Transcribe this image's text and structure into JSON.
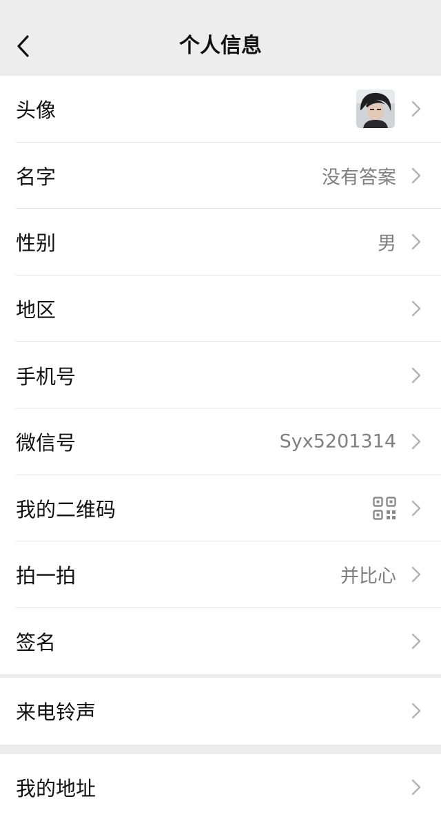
{
  "header": {
    "title": "个人信息"
  },
  "rows": [
    {
      "label": "头像"
    },
    {
      "label": "名字",
      "value": "没有答案"
    },
    {
      "label": "性别",
      "value": "男"
    },
    {
      "label": "地区"
    },
    {
      "label": "手机号"
    },
    {
      "label": "微信号",
      "value": "Syx5201314"
    },
    {
      "label": "我的二维码"
    },
    {
      "label": "拍一拍",
      "value": "并比心"
    },
    {
      "label": "签名"
    }
  ],
  "group2": [
    {
      "label": "来电铃声"
    }
  ],
  "group3": [
    {
      "label": "我的地址"
    }
  ],
  "icons": {
    "back": "chevron-left-icon",
    "chevron": "chevron-right-icon",
    "qr": "qr-code-icon"
  },
  "colors": {
    "background": "#ededed",
    "value_text": "#7f7f7f"
  }
}
